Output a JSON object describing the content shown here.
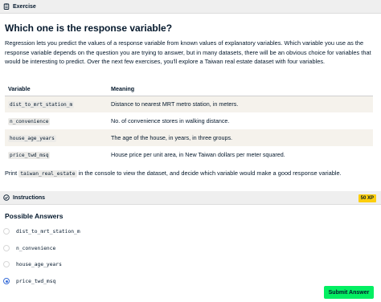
{
  "exercise_panel": {
    "header_label": "Exercise",
    "header_icon": "clipboard-icon",
    "title": "Which one is the response variable?",
    "intro": "Regression lets you predict the values of a response variable from known values of explanatory variables. Which variable you use as the response variable depends on the question you are trying to answer, but in many datasets, there will be an obvious choice for variables that would be interesting to predict. Over the next few exercises, you'll explore a Taiwan real estate dataset with four variables.",
    "table": {
      "headers": [
        "Variable",
        "Meaning"
      ],
      "rows": [
        {
          "variable": "dist_to_mrt_station_m",
          "meaning": "Distance to nearest MRT metro station, in meters."
        },
        {
          "variable": "n_convenience",
          "meaning": "No. of convenience stores in walking distance."
        },
        {
          "variable": "house_age_years",
          "meaning": "The age of the house, in years, in three groups."
        },
        {
          "variable": "price_twd_msq",
          "meaning": "House price per unit area, in New Taiwan dollars per meter squared."
        }
      ]
    },
    "print_prefix": "Print",
    "print_code": "taiwan_real_estate",
    "print_suffix": "in the console to view the dataset, and decide which variable would make a good response variable."
  },
  "instructions_panel": {
    "header_label": "Instructions",
    "header_icon": "check-circle-icon",
    "xp_badge": "50 XP",
    "answers_title": "Possible Answers",
    "options": [
      {
        "label": "dist_to_mrt_station_m",
        "selected": false
      },
      {
        "label": "n_convenience",
        "selected": false
      },
      {
        "label": "house_age_years",
        "selected": false
      },
      {
        "label": "price_twd_msq",
        "selected": true
      }
    ],
    "submit_label": "Submit Answer"
  },
  "colors": {
    "accent_green": "#03ef62",
    "xp_yellow": "#fcce0d",
    "radio_selected": "#3b6fd8",
    "text_navy": "#05192d"
  }
}
